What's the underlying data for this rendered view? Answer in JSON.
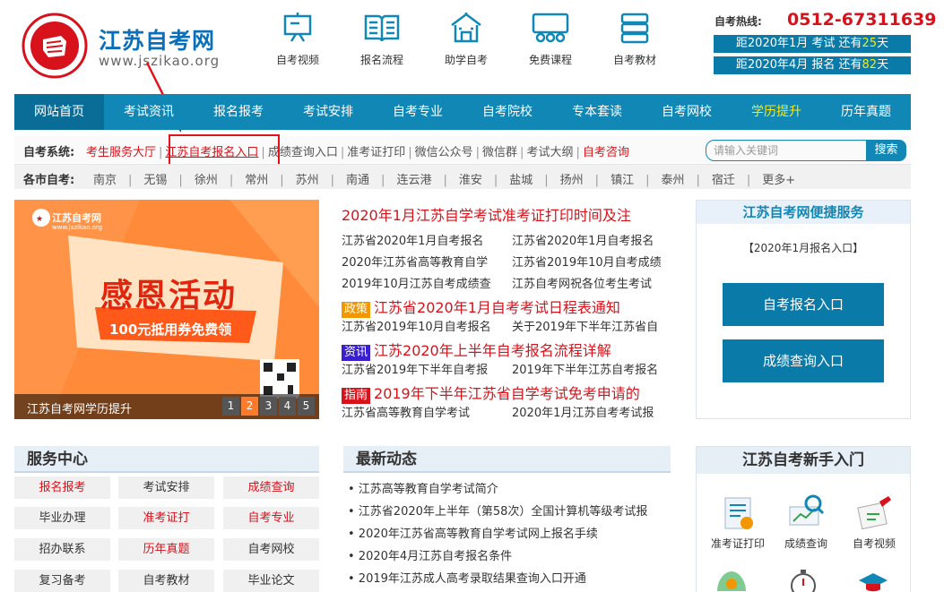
{
  "header": {
    "site_name": "江苏自考网",
    "site_url": "www.jszikao.org",
    "icons": [
      {
        "label": "自考视频",
        "icon": "easel-icon"
      },
      {
        "label": "报名流程",
        "icon": "book-icon"
      },
      {
        "label": "助学自考",
        "icon": "school-icon"
      },
      {
        "label": "免费课程",
        "icon": "classroom-icon"
      },
      {
        "label": "自考教材",
        "icon": "books-stack-icon"
      }
    ],
    "hotline_label": "自考热线:",
    "hotline_number": "0512-67311639",
    "countdown": [
      {
        "prefix": "距2020年1月 考试 还有",
        "days": "25",
        "suffix": "天"
      },
      {
        "prefix": "距2020年4月 报名 还有",
        "days": "82",
        "suffix": "天"
      }
    ]
  },
  "nav": [
    "网站首页",
    "考试资讯",
    "报名报考",
    "考试安排",
    "自考专业",
    "自考院校",
    "专本套读",
    "自考网校",
    "学历提升",
    "历年真题"
  ],
  "system_bar": {
    "label": "自考系统:",
    "links": [
      "考生服务大厅",
      "江苏自考报名入口",
      "成绩查询入口",
      "准考证打印",
      "微信公众号",
      "微信群",
      "考试大纲",
      "自考咨询"
    ],
    "search_placeholder": "请输入关键词",
    "search_button": "搜索"
  },
  "city_bar": {
    "label": "各市自考:",
    "cities": [
      "南京",
      "无锡",
      "徐州",
      "常州",
      "苏州",
      "南通",
      "连云港",
      "淮安",
      "盐城",
      "扬州",
      "镇江",
      "泰州",
      "宿迁",
      "更多+"
    ]
  },
  "banner": {
    "logo_text": "江苏自考网",
    "logo_url": "www.jszikao.org",
    "headline": "感恩活动",
    "ribbon": "100元抵用券免费领",
    "caption": "江苏自考网学历提升",
    "pages": [
      "1",
      "2",
      "3",
      "4",
      "5"
    ]
  },
  "news": {
    "headline": "2020年1月江苏自学考试准考证打印时间及注",
    "rows1": [
      [
        "江苏省2020年1月自考报名",
        "江苏省2020年1月自考报名"
      ],
      [
        "2020年江苏省高等教育自学",
        "江苏省2019年10月自考成绩"
      ],
      [
        "2019年10月江苏自考成绩查",
        "江苏自考网祝各位考生考试"
      ]
    ],
    "group2": {
      "tag": "政策",
      "tag_color": "#f39700",
      "headline": "江苏省2020年1月自考考试日程表通知",
      "row": [
        "江苏省2019年10月自考报名",
        "关于2019年下半年江苏省自"
      ]
    },
    "group3": {
      "tag": "资讯",
      "tag_color": "#3a1fcf",
      "headline": "江苏2020年上半年自考报名流程详解",
      "row": [
        "江苏省2019年下半年自考报",
        "2019年下半年江苏自考报名"
      ]
    },
    "group4": {
      "tag": "指南",
      "tag_color": "#d8121b",
      "headline": "2019年下半年江苏省自学考试免考申请的",
      "row": [
        "江苏省高等教育自学考试",
        "2020年1月江苏自考考试报"
      ]
    }
  },
  "quick": {
    "title": "江苏自考网便捷服务",
    "subtitle": "【2020年1月报名入口】",
    "btn1": "自考报名入口",
    "btn2": "成绩查询入口"
  },
  "service": {
    "title": "服务中心",
    "items": [
      {
        "label": "报名报考",
        "red": true
      },
      {
        "label": "考试安排",
        "red": false
      },
      {
        "label": "成绩查询",
        "red": true
      },
      {
        "label": "毕业办理",
        "red": false
      },
      {
        "label": "准考证打",
        "red": true
      },
      {
        "label": "自考专业",
        "red": true
      },
      {
        "label": "招办联系",
        "red": false
      },
      {
        "label": "历年真题",
        "red": true
      },
      {
        "label": "自考网校",
        "red": false
      },
      {
        "label": "复习备考",
        "red": false
      },
      {
        "label": "自考教材",
        "red": false
      },
      {
        "label": "毕业论文",
        "red": false
      }
    ]
  },
  "latest": {
    "title": "最新动态",
    "items": [
      "• 江苏高等教育自学考试简介",
      "• 江苏省2020年上半年（第58次）全国计算机等级考试报",
      "• 2020年江苏省高等教育自学考试网上报名手续",
      "• 2020年4月江苏自考报名条件",
      "• 2019年江苏成人高考录取结果查询入口开通"
    ]
  },
  "beginner": {
    "title": "江苏自考新手入门",
    "items": [
      "准考证打印",
      "成绩查询",
      "自考视频"
    ]
  },
  "colors": {
    "primary": "#1187b5",
    "accent_red": "#d8121b",
    "highlight_yellow": "#ffea00"
  }
}
